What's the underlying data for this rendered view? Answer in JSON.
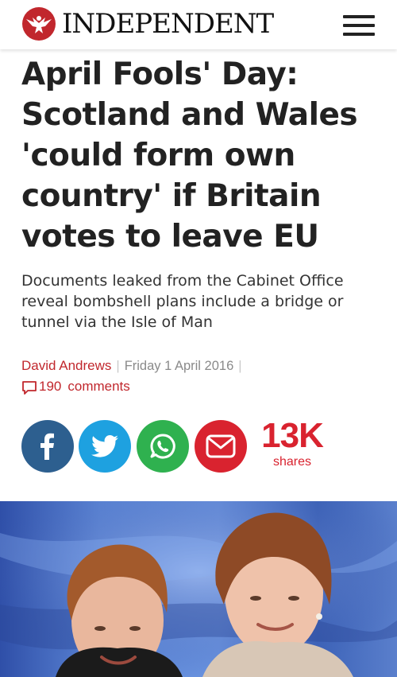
{
  "header": {
    "brand": "INDEPENDENT",
    "menu_icon": "hamburger-menu-icon",
    "brand_color": "#c1272d"
  },
  "article": {
    "headline": "April Fools' Day: Scotland and Wales 'could form own country' if Britain votes to leave EU",
    "standfirst": "Documents leaked from the Cabinet Office reveal bombshell plans include a bridge or tunnel via the Isle of Man",
    "author": "David Andrews",
    "date": "Friday 1 April 2016",
    "comments_count": "190",
    "comments_label": "comments"
  },
  "share": {
    "count": "13K",
    "label": "shares",
    "buttons": [
      {
        "icon": "facebook-icon",
        "color": "#2d5f8f"
      },
      {
        "icon": "twitter-icon",
        "color": "#1ea1e0"
      },
      {
        "icon": "whatsapp-icon",
        "color": "#2fb14f"
      },
      {
        "icon": "email-icon",
        "color": "#d9232f"
      }
    ]
  }
}
